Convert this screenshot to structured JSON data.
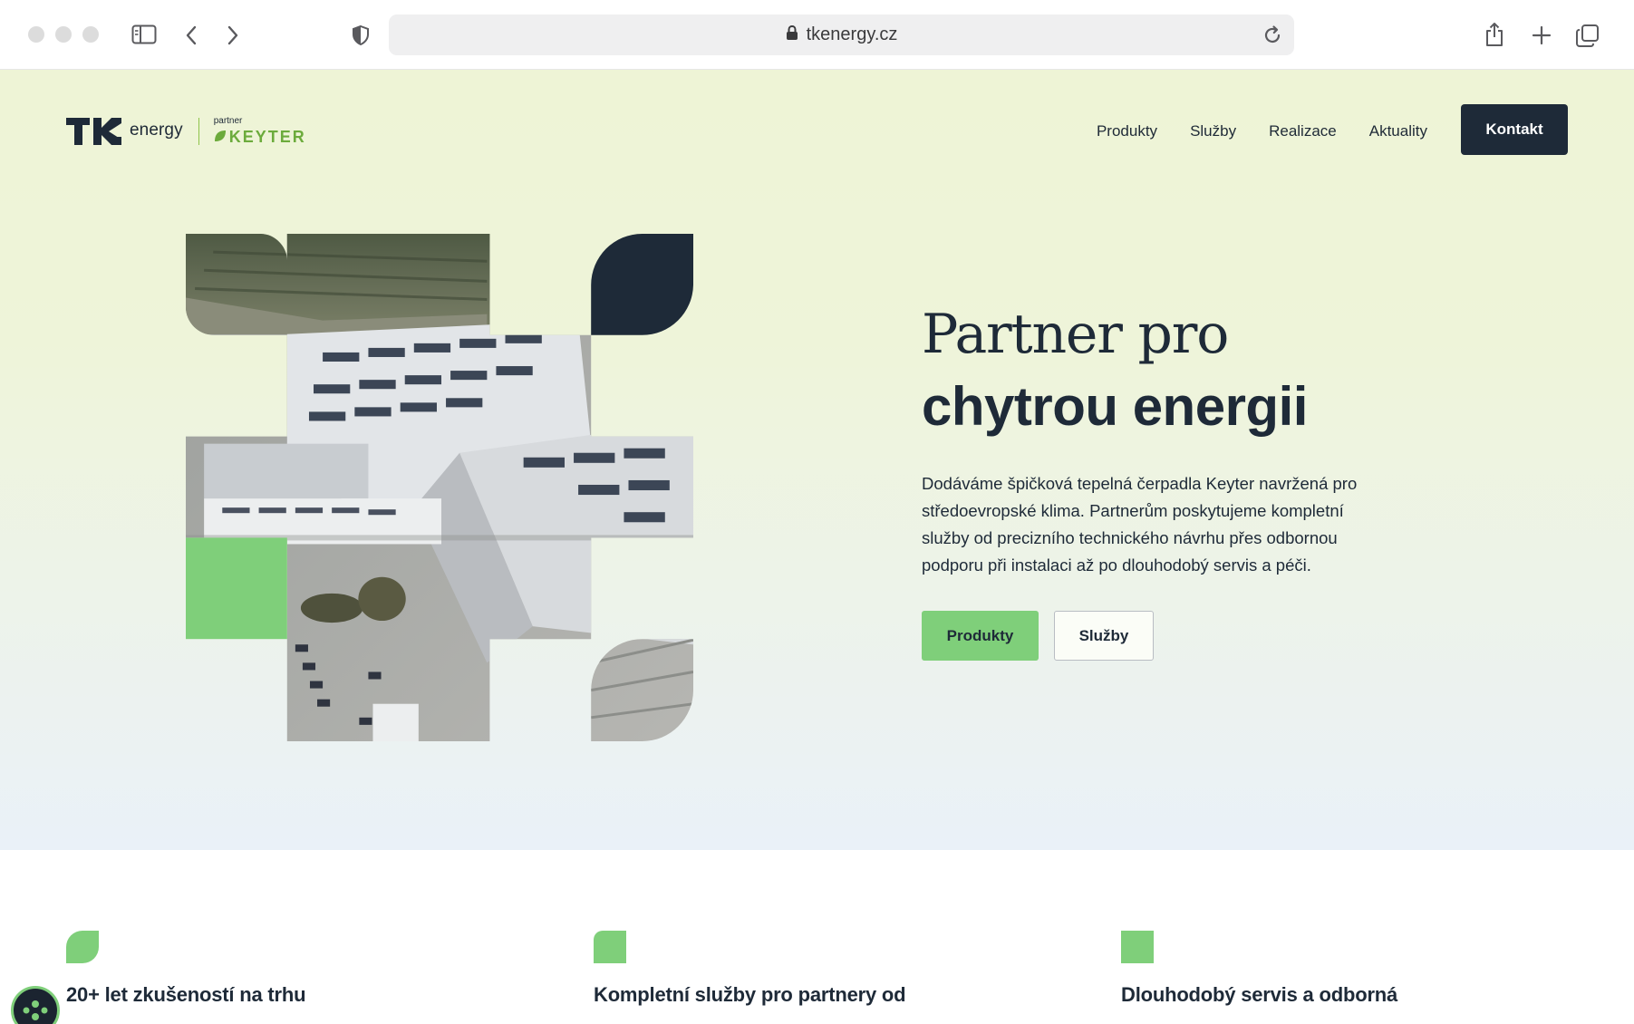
{
  "browser": {
    "url": "tkenergy.cz",
    "icons": [
      "sidebar-icon",
      "back-icon",
      "forward-icon",
      "shield-icon",
      "lock-icon",
      "reload-icon",
      "share-icon",
      "new-tab-icon",
      "tabs-overview-icon"
    ]
  },
  "header": {
    "logo_word": "energy",
    "partner_small": "partner",
    "partner_brand": "KEYTER",
    "nav": [
      "Produkty",
      "Služby",
      "Realizace",
      "Aktuality"
    ],
    "cta": "Kontakt"
  },
  "hero": {
    "headline_line1": "Partner pro",
    "headline_line2": "chytrou energii",
    "paragraph": "Dodáváme špičková tepelná čerpadla Keyter navržená pro středoevropské klima. Partnerům poskytujeme kompletní služby od precizního technického návrhu přes odbornou podporu při instalaci až po dlouhodobý servis a péči.",
    "button_primary": "Produkty",
    "button_secondary": "Služby"
  },
  "features": [
    {
      "title": "20+ let zkušeností na trhu"
    },
    {
      "title": "Kompletní služby pro partnery od"
    },
    {
      "title": "Dlouhodobý servis a odborná"
    }
  ],
  "colors": {
    "navy": "#1e2a38",
    "green": "#7fcf7a",
    "keyter_green": "#6cab3c"
  }
}
